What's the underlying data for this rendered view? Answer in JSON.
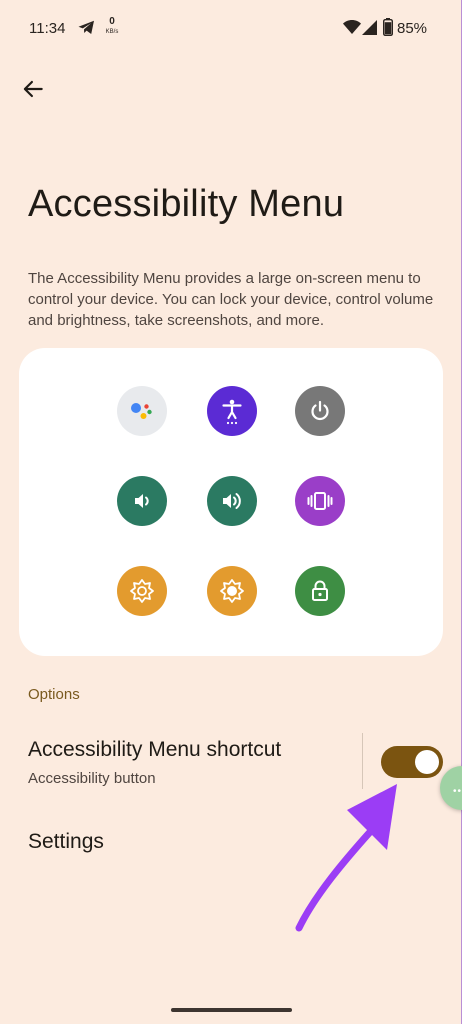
{
  "status_bar": {
    "time": "11:34",
    "net_speed_value": "0",
    "net_speed_unit": "KB/s",
    "battery_percent": "85%"
  },
  "page": {
    "title": "Accessibility Menu",
    "description": "The Accessibility Menu provides a large on-screen menu to control your device. You can lock your device, control volume and brightness, take screenshots, and more."
  },
  "preview_tiles": [
    {
      "name": "assistant-icon",
      "color": "#e8eaed"
    },
    {
      "name": "accessibility-settings-icon",
      "color": "#5b2bd4"
    },
    {
      "name": "power-icon",
      "color": "#787878"
    },
    {
      "name": "volume-down-icon",
      "color": "#2b7a62"
    },
    {
      "name": "volume-up-icon",
      "color": "#2b7a62"
    },
    {
      "name": "vibrate-icon",
      "color": "#9a3ec8"
    },
    {
      "name": "brightness-down-icon",
      "color": "#e39b2e"
    },
    {
      "name": "brightness-up-icon",
      "color": "#e39b2e"
    },
    {
      "name": "lock-icon",
      "color": "#3e8e44"
    }
  ],
  "options": {
    "header": "Options",
    "shortcut": {
      "label": "Accessibility Menu shortcut",
      "sublabel": "Accessibility button",
      "enabled": true
    },
    "settings_label": "Settings"
  },
  "colors": {
    "background": "#fcebdf",
    "toggle_on": "#7b5410",
    "annotation_arrow": "#9b3df5"
  }
}
